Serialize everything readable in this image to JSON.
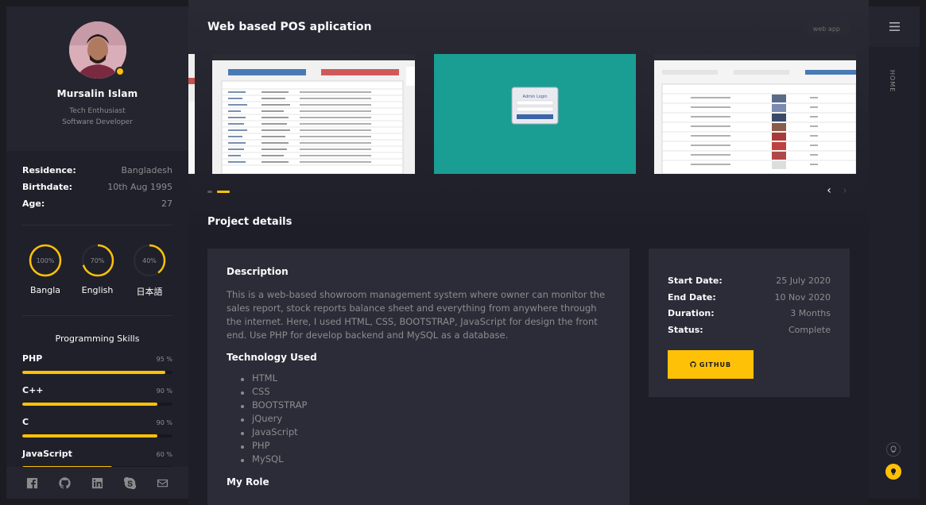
{
  "profile": {
    "name": "Mursalin Islam",
    "roles": [
      "Tech Enthusiast",
      "Software Developer"
    ]
  },
  "info": [
    {
      "label": "Residence:",
      "value": "Bangladesh"
    },
    {
      "label": "Birthdate:",
      "value": "10th Aug 1995"
    },
    {
      "label": "Age:",
      "value": "27"
    }
  ],
  "languages": [
    {
      "name": "Bangla",
      "percent": "100%",
      "level": 100
    },
    {
      "name": "English",
      "percent": "70%",
      "level": 70
    },
    {
      "name": "日本語",
      "percent": "40%",
      "level": 40
    }
  ],
  "skills": {
    "title": "Programming Skills",
    "items": [
      {
        "name": "PHP",
        "percent": "95 %",
        "level": 95
      },
      {
        "name": "C++",
        "percent": "90 %",
        "level": 90
      },
      {
        "name": "C",
        "percent": "90 %",
        "level": 90
      },
      {
        "name": "JavaScript",
        "percent": "60 %",
        "level": 60
      }
    ]
  },
  "social": [
    "facebook-icon",
    "github-icon",
    "linkedin-icon",
    "skype-icon",
    "mail-icon"
  ],
  "project": {
    "title": "Web based POS aplication",
    "tag": "web app",
    "slider_images": [
      "table-screenshot",
      "admin-login-screenshot",
      "product-table-screenshot"
    ],
    "carousel": {
      "slide_count": 2,
      "active_slide": 2
    },
    "section_title": "Project details",
    "description_heading": "Description",
    "description": "This is a web-based showroom management system where owner can monitor the sales report, stock reports balance sheet and everything from anywhere through the internet. Here, I used HTML, CSS, BOOTSTRAP, JavaScript for design the front end. Use PHP for develop backend and MySQL as a database.",
    "tech_heading": "Technology Used",
    "technologies": [
      "HTML",
      "CSS",
      "BOOTSTRAP",
      "jQuery",
      "JavaScript",
      "PHP",
      "MySQL"
    ],
    "role_heading": "My Role",
    "meta": [
      {
        "label": "Start Date:",
        "value": "25 July 2020"
      },
      {
        "label": "End Date:",
        "value": "10 Nov 2020"
      },
      {
        "label": "Duration:",
        "value": "3 Months"
      },
      {
        "label": "Status:",
        "value": "Complete"
      }
    ],
    "github_label": "GITHUB",
    "admin_login_text": "Admin Login"
  },
  "nav": {
    "home_label": "HOME"
  },
  "colors": {
    "accent": "#ffc107",
    "background": "#1e1e28",
    "card": "#2c2c38",
    "sidebar": "#20202a",
    "muted_text": "#8c8c8e"
  }
}
